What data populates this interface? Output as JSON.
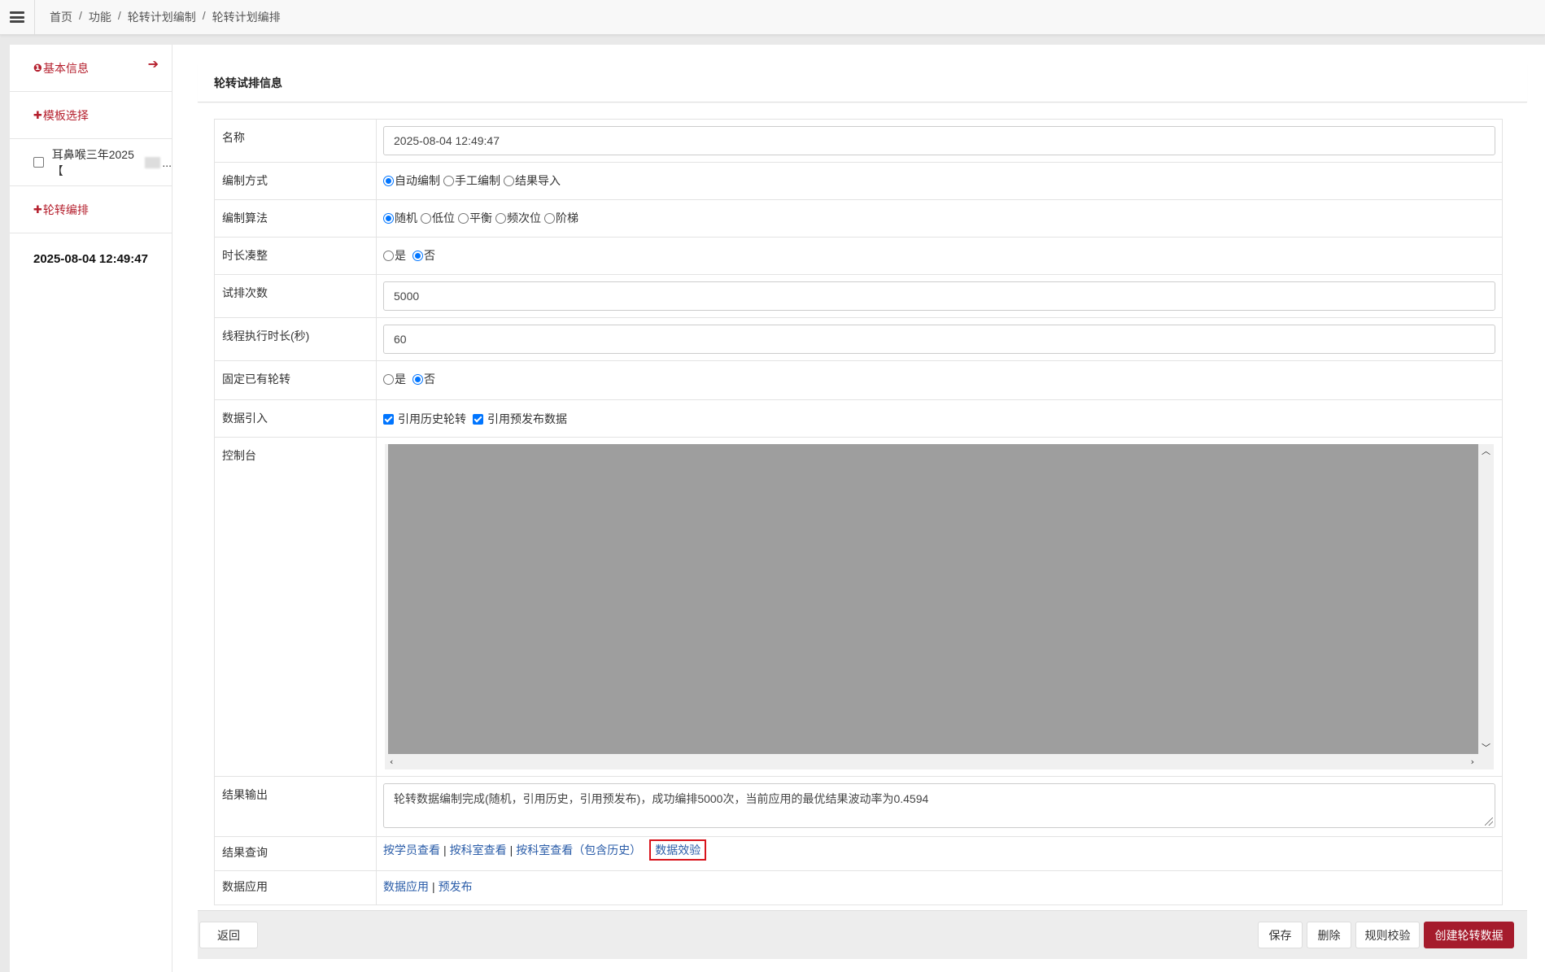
{
  "breadcrumb": {
    "home": "首页",
    "func": "功能",
    "plan": "轮转计划编制",
    "current": "轮转计划编排"
  },
  "sidebar": {
    "basic_info": "基本信息",
    "template_select": "模板选择",
    "dept_item": "耳鼻喉三年2025【",
    "dept_item_suffix": "...",
    "rotation": "轮转编排",
    "date": "2025-08-04 12:49:47"
  },
  "panel": {
    "title": "轮转试排信息",
    "fields": {
      "name": {
        "label": "名称",
        "value": "2025-08-04 12:49:47"
      },
      "method": {
        "label": "编制方式",
        "options": [
          "自动编制",
          "手工编制",
          "结果导入"
        ],
        "selected": "自动编制"
      },
      "algorithm": {
        "label": "编制算法",
        "options": [
          "随机",
          "低位",
          "平衡",
          "频次位",
          "阶梯"
        ],
        "selected": "随机"
      },
      "duration_fit": {
        "label": "时长凑整",
        "options": [
          "是",
          "否"
        ],
        "selected": "否"
      },
      "trials": {
        "label": "试排次数",
        "value": "5000"
      },
      "thread_time": {
        "label": "线程执行时长(秒)",
        "value": "60"
      },
      "fix_existing": {
        "label": "固定已有轮转",
        "options": [
          "是",
          "否"
        ],
        "selected": "否"
      },
      "data_import": {
        "label": "数据引入",
        "options": [
          "引用历史轮转",
          "引用预发布数据"
        ]
      },
      "console": {
        "label": "控制台"
      },
      "output": {
        "label": "结果输出",
        "value": "轮转数据编制完成(随机，引用历史，引用预发布)，成功编排5000次，当前应用的最优结果波动率为0.4594"
      },
      "query": {
        "label": "结果查询",
        "links": [
          "按学员查看",
          "按科室查看",
          "按科室查看（包含历史）",
          "数据效验"
        ]
      },
      "apply": {
        "label": "数据应用",
        "links": [
          "数据应用",
          "预发布"
        ]
      }
    }
  },
  "footer": {
    "back": "返回",
    "save": "保存",
    "delete": "删除",
    "rule_check": "规则校验",
    "create": "创建轮转数据"
  },
  "colors": {
    "accent": "#a51b2c",
    "link": "#2a5ca8",
    "radio": "#0075ff",
    "highlight": "#d8141c"
  }
}
